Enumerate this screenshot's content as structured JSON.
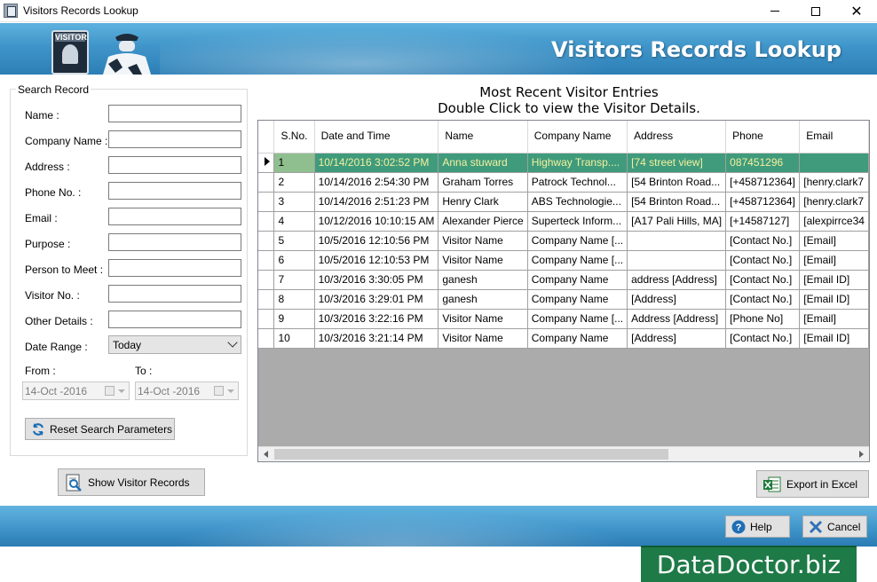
{
  "window": {
    "title": "Visitors Records Lookup",
    "minimize_label": "—",
    "close_label": "✕"
  },
  "banner": {
    "title": "Visitors Records Lookup",
    "badge_text": "VISITOR"
  },
  "search": {
    "group_label": "Search Record",
    "fields": [
      {
        "label": "Name :",
        "value": ""
      },
      {
        "label": "Company Name :",
        "value": ""
      },
      {
        "label": "Address :",
        "value": ""
      },
      {
        "label": "Phone No. :",
        "value": ""
      },
      {
        "label": "Email :",
        "value": ""
      },
      {
        "label": "Purpose :",
        "value": ""
      },
      {
        "label": "Person to Meet :",
        "value": ""
      },
      {
        "label": "Visitor No. :",
        "value": ""
      },
      {
        "label": "Other Details :",
        "value": ""
      }
    ],
    "date_range_label": "Date Range :",
    "date_range_value": "Today",
    "from_label": "From :",
    "to_label": "To :",
    "from_value": "14-Oct -2016",
    "to_value": "14-Oct -2016",
    "reset_button": "Reset Search Parameters"
  },
  "show_button": "Show Visitor Records",
  "grid": {
    "heading_line1": "Most Recent Visitor Entries",
    "heading_line2": "Double Click to view the Visitor Details.",
    "columns": [
      "S.No.",
      "Date and Time",
      "Name",
      "Company Name",
      "Address",
      "Phone",
      "Email"
    ],
    "rows": [
      [
        "1",
        "10/14/2016 3:02:52 PM",
        "Anna stuward",
        "Highway Transp....",
        "[74 street view]",
        "087451296",
        ""
      ],
      [
        "2",
        "10/14/2016 2:54:30 PM",
        "Graham Torres",
        "Patrock Technol...",
        "[54 Brinton Road...",
        "[+458712364]",
        "[henry.clark7"
      ],
      [
        "3",
        "10/14/2016 2:51:23 PM",
        "Henry Clark",
        "ABS Technologie...",
        "[54 Brinton Road...",
        "[+458712364]",
        "[henry.clark7"
      ],
      [
        "4",
        "10/12/2016 10:10:15 AM",
        "Alexander Pierce",
        "Superteck Inform...",
        "[A17 Pali Hills, MA]",
        "[+14587127]",
        "[alexpirrce34"
      ],
      [
        "5",
        "10/5/2016 12:10:56 PM",
        "Visitor Name",
        "Company Name [...",
        "",
        "[Contact No.]",
        "[Email]"
      ],
      [
        "6",
        "10/5/2016 12:10:53 PM",
        "Visitor Name",
        "Company Name [...",
        "",
        "[Contact No.]",
        "[Email]"
      ],
      [
        "7",
        "10/3/2016 3:30:05 PM",
        "ganesh",
        "Company Name",
        "address [Address]",
        "[Contact No.]",
        "[Email ID]"
      ],
      [
        "8",
        "10/3/2016 3:29:01 PM",
        "ganesh",
        "Company Name",
        "[Address]",
        "[Contact No.]",
        "[Email ID]"
      ],
      [
        "9",
        "10/3/2016 3:22:16 PM",
        "Visitor Name",
        "Company Name [...",
        "Address [Address]",
        "[Phone No]",
        "[Email]"
      ],
      [
        "10",
        "10/3/2016 3:21:14 PM",
        "Visitor Name",
        "Company Name",
        "[Address]",
        "[Contact No.]",
        "[Email ID]"
      ]
    ],
    "selected_row": 0,
    "selected_color": "#3f9b7b"
  },
  "export_button": "Export in Excel",
  "help_button": "Help",
  "cancel_button": "Cancel",
  "brand_text": "DataDoctor.biz",
  "colors": {
    "banner": "#3f95c9",
    "brand_bg": "#1e7a47"
  }
}
